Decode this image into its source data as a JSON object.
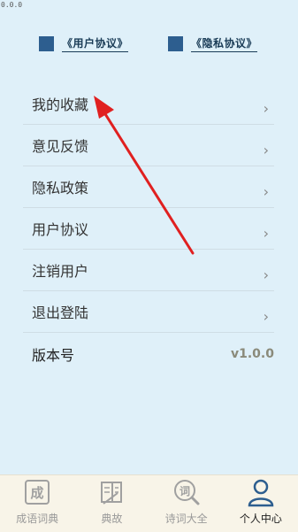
{
  "corner_text": "0.0.0",
  "links": {
    "user_agreement": "《用户协议》",
    "privacy_agreement": "《隐私协议》"
  },
  "menu": {
    "items": [
      {
        "label": "我的收藏"
      },
      {
        "label": "意见反馈"
      },
      {
        "label": "隐私政策"
      },
      {
        "label": "用户协议"
      },
      {
        "label": "注销用户"
      },
      {
        "label": "退出登陆"
      }
    ],
    "chevron": "›"
  },
  "version": {
    "label": "版本号",
    "value": "v1.0.0"
  },
  "tabbar": {
    "tabs": [
      {
        "label": "成语词典",
        "icon": "idiom-dictionary-icon",
        "icon_char": "成"
      },
      {
        "label": "典故",
        "icon": "allusion-book-icon"
      },
      {
        "label": "诗词大全",
        "icon": "poetry-search-icon",
        "icon_char": "词"
      },
      {
        "label": "个人中心",
        "icon": "person-icon"
      }
    ],
    "active_index": 3
  },
  "colors": {
    "background": "#dff0f9",
    "accent": "#2d5e8f",
    "arrow": "#e02020",
    "tabbar": "#f8f4e8"
  }
}
